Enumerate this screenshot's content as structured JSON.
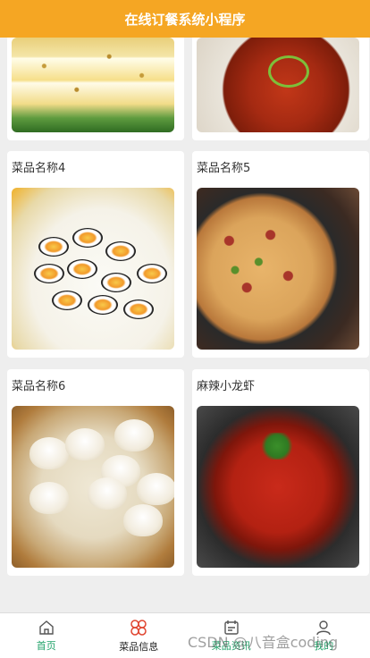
{
  "header": {
    "title": "在线订餐系统小程序"
  },
  "dishes": [
    {
      "name": "菜品名称4"
    },
    {
      "name": "菜品名称5"
    },
    {
      "name": "菜品名称6"
    },
    {
      "name": "麻辣小龙虾"
    }
  ],
  "nav": {
    "items": [
      {
        "label": "首页",
        "icon": "home-icon"
      },
      {
        "label": "菜品信息",
        "icon": "clover-icon"
      },
      {
        "label": "菜品资讯",
        "icon": "calendar-icon"
      },
      {
        "label": "我的",
        "icon": "user-icon"
      }
    ]
  },
  "watermark": "CSDN @八音盒coding",
  "colors": {
    "header": "#f5a623",
    "nav_active": "#e0442f",
    "nav_green": "#22a36a"
  }
}
